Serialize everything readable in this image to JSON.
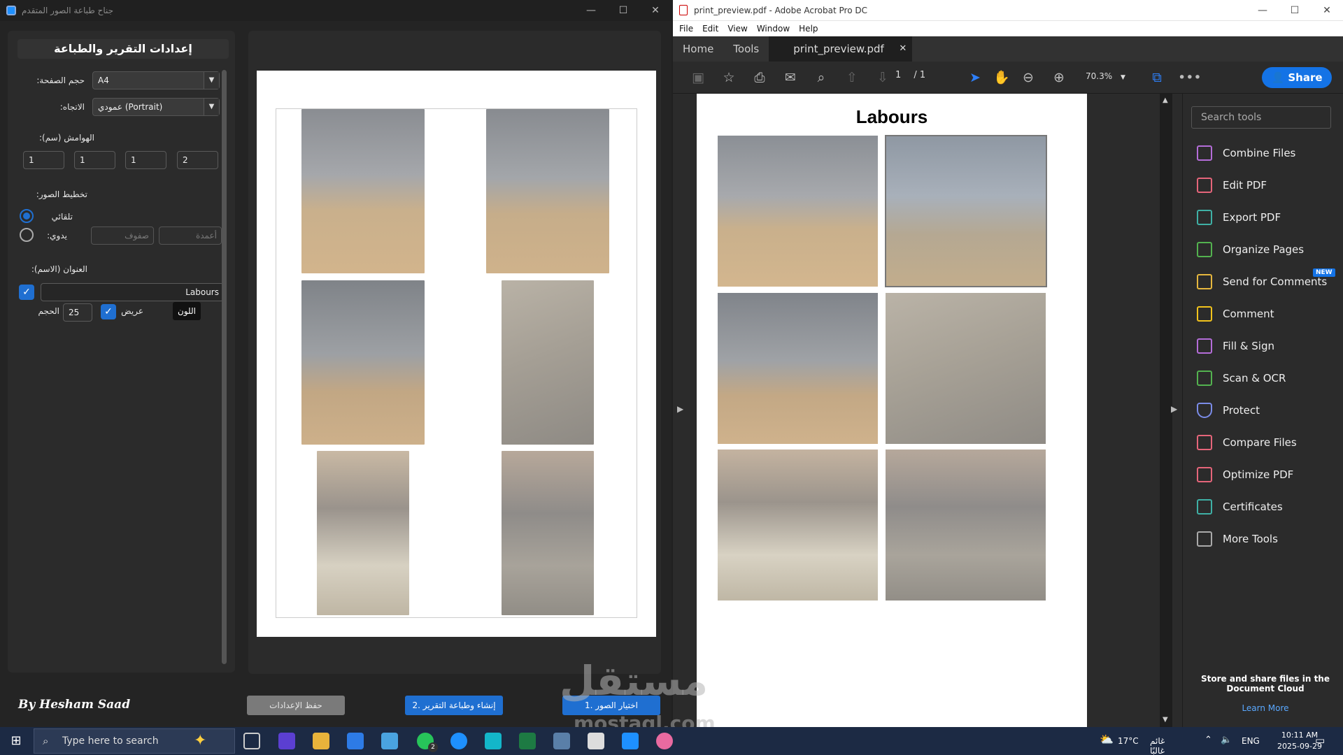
{
  "left_app": {
    "window_title": "جناح طباعة الصور المتقدم",
    "settings_title": "إعدادات التقرير والطباعة",
    "page_size_label": "حجم الصفحة:",
    "page_size_value": "A4",
    "orientation_label": "الاتجاه:",
    "orientation_value": "عمودي (Portrait)",
    "margins_label": "الهوامش (سم):",
    "margins": [
      "1",
      "1",
      "1",
      "2"
    ],
    "layout_label": "تخطيط الصور:",
    "auto_label": "تلقائي",
    "manual_label": "يدوي:",
    "rows_placeholder": "صفوف",
    "cols_placeholder": "أعمدة",
    "title_label": "العنوان (الاسم):",
    "title_value": "Labours",
    "size_label": "الحجم",
    "size_value": "25",
    "bold_label": "عريض",
    "color_button": "اللون",
    "signature": "By Hesham Saad",
    "save_button": "حفظ الإعدادات",
    "generate_button": "2. إنشاء وطباعة التقرير",
    "select_button": "1. اختيار الصور"
  },
  "acrobat": {
    "window_title": "print_preview.pdf - Adobe Acrobat Pro DC",
    "menu": [
      "File",
      "Edit",
      "View",
      "Window",
      "Help"
    ],
    "tabs": {
      "home": "Home",
      "tools": "Tools",
      "document": "print_preview.pdf"
    },
    "page_current": "1",
    "page_total": "/ 1",
    "zoom": "70.3%",
    "share": "Share",
    "pdf_title": "Labours",
    "search_placeholder": "Search tools",
    "tools": [
      "Combine Files",
      "Edit PDF",
      "Export PDF",
      "Organize Pages",
      "Send for Comments",
      "Comment",
      "Fill & Sign",
      "Scan & OCR",
      "Protect",
      "Compare Files",
      "Optimize PDF",
      "Certificates",
      "More Tools"
    ],
    "new_badge": "NEW",
    "cloud_text": "Store and share files in the Document Cloud",
    "learn_more": "Learn More"
  },
  "taskbar": {
    "search_placeholder": "Type here to search",
    "temperature": "17°C",
    "weather": "غائم غالبًا",
    "language": "ENG",
    "time": "10:11 AM",
    "date": "2025-09-29",
    "whatsapp_badge": "2"
  },
  "watermark": {
    "arabic": "مستقل",
    "latin": "mostaql.com"
  },
  "colors": {
    "accent": "#1f6fd1",
    "acrobat_blue": "#1473e6",
    "taskbar": "#1c2a44"
  }
}
